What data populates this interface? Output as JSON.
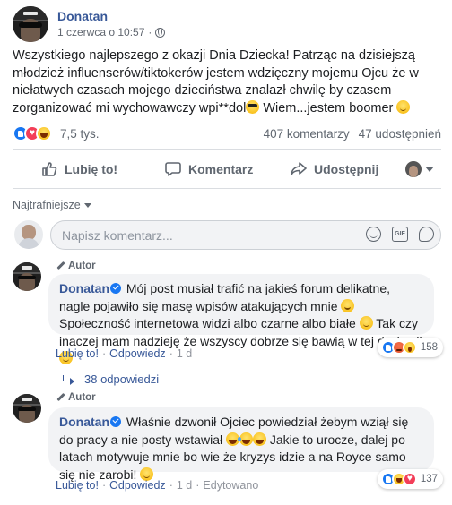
{
  "post": {
    "author": "Donatan",
    "date": "1 czerwca o 10:57",
    "separator": "·",
    "text_parts": [
      "Wszystkiego najlepszego z okazji Dnia Dziecka! Patrząc na dzisiejszą młodzież influenserów/tiktokerów jestem wdzięczny mojemu Ojcu że w niełatwych czasach mojego dzieciństwa znalazł chwilę by czasem zorganizować mi wychowawczy wpi**dol",
      " Wiem...jestem boomer "
    ],
    "emojis": [
      "sunglasses-emoji",
      "slightly-smiling-emoji"
    ]
  },
  "stats": {
    "reaction_types": [
      "like",
      "love",
      "haha"
    ],
    "reaction_count": "7,5 tys.",
    "comments": "407 komentarzy",
    "shares": "47 udostępnień"
  },
  "actions": {
    "like": "Lubię to!",
    "comment": "Komentarz",
    "share": "Udostępnij"
  },
  "comments_section": {
    "sort": "Najtrafniejsze",
    "placeholder": "Napisz komentarz...",
    "gif_label": "GIF"
  },
  "comments": [
    {
      "badge": "Autor",
      "author": "Donatan",
      "text_parts": [
        "Mój post musiał trafić na jakieś forum delikatne, nagle pojawiło się masę wpisów atakujących mnie ",
        " Społeczność internetowa widzi albo czarne albo białe ",
        " Tak czy inaczej mam nadzieję że wszyscy dobrze się bawią w tej dyskusji "
      ],
      "reaction_types": [
        "like",
        "angry",
        "wow"
      ],
      "reaction_count": "158",
      "like": "Lubię to!",
      "reply": "Odpowiedz",
      "time": "1 d",
      "replies": "38 odpowiedzi",
      "edited": ""
    },
    {
      "badge": "Autor",
      "author": "Donatan",
      "text_parts": [
        "Właśnie dzwonił Ojciec powiedział żebym wziął się do pracy a nie posty wstawiał ",
        " Jakie to urocze, dalej po latach motywuje mnie bo wie że kryzys idzie a na Royce samo się nie zarobi! "
      ],
      "reaction_types": [
        "like",
        "haha",
        "love"
      ],
      "reaction_count": "137",
      "like": "Lubię to!",
      "reply": "Odpowiedz",
      "time": "1 d",
      "edited": "Edytowano"
    }
  ],
  "colors": {
    "link": "#385898",
    "facebook_blue": "#1877f2",
    "meta_gray": "#606770",
    "bubble": "#f2f3f5"
  }
}
